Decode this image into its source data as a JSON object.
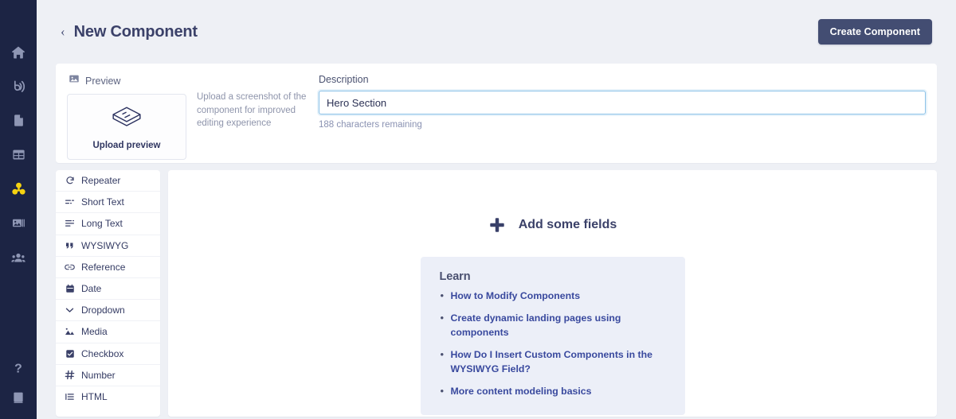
{
  "sidebar": {
    "items": [
      {
        "name": "home",
        "icon": "home-icon",
        "active": false
      },
      {
        "name": "blog",
        "icon": "blog-signal-icon",
        "active": false
      },
      {
        "name": "pages",
        "icon": "document-icon",
        "active": false
      },
      {
        "name": "tables",
        "icon": "table-grid-icon",
        "active": false
      },
      {
        "name": "components",
        "icon": "components-cubes-icon",
        "active": true
      },
      {
        "name": "media",
        "icon": "media-gallery-icon",
        "active": false
      },
      {
        "name": "users",
        "icon": "users-icon",
        "active": false
      }
    ],
    "bottom_items": [
      {
        "name": "help",
        "icon": "question-mark-icon"
      },
      {
        "name": "documentation",
        "icon": "book-icon"
      }
    ],
    "background_color": "#1c2444",
    "active_color": "#f5d211"
  },
  "header": {
    "back_label": "‹",
    "title": "New Component",
    "create_button": "Create Component",
    "create_button_color": "#434d72"
  },
  "preview": {
    "label": "Preview",
    "upload_label": "Upload preview",
    "hint": "Upload a screenshot of the component for improved editing experience"
  },
  "description": {
    "label": "Description",
    "value": "Hero Section",
    "placeholder": "",
    "counter": "188 characters remaining"
  },
  "field_types": [
    {
      "label": "Repeater",
      "icon": "repeat-icon"
    },
    {
      "label": "Short Text",
      "icon": "short-text-icon"
    },
    {
      "label": "Long Text",
      "icon": "long-text-icon"
    },
    {
      "label": "WYSIWYG",
      "icon": "quote-icon"
    },
    {
      "label": "Reference",
      "icon": "link-icon"
    },
    {
      "label": "Date",
      "icon": "calendar-icon"
    },
    {
      "label": "Dropdown",
      "icon": "chevron-down-icon"
    },
    {
      "label": "Media",
      "icon": "media-icon"
    },
    {
      "label": "Checkbox",
      "icon": "checkbox-icon"
    },
    {
      "label": "Number",
      "icon": "hash-icon"
    },
    {
      "label": "HTML",
      "icon": "list-icon"
    }
  ],
  "content": {
    "add_fields_label": "Add some fields",
    "learn": {
      "title": "Learn",
      "background_color": "#eceff8",
      "link_color": "#39499e",
      "links": [
        "How to Modify Components",
        "Create dynamic landing pages using components",
        "How Do I Insert Custom Components in the WYSIWYG Field?",
        "More content modeling basics"
      ]
    }
  }
}
